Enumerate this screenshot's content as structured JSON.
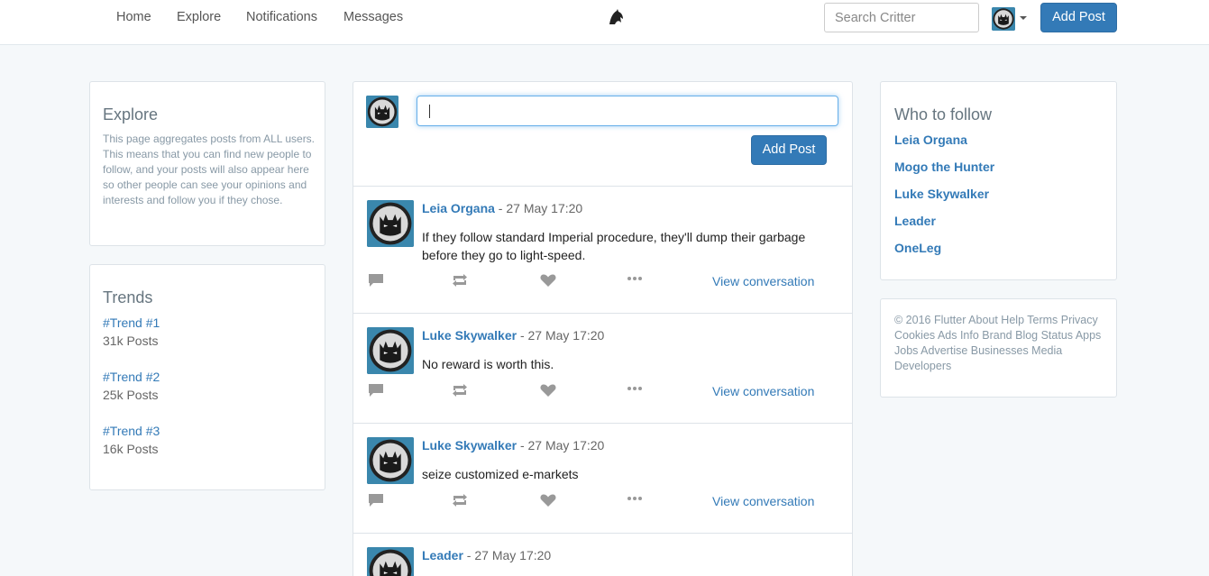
{
  "nav": {
    "links": [
      "Home",
      "Explore",
      "Notifications",
      "Messages"
    ],
    "search_placeholder": "Search Critter",
    "add_post_label": "Add Post"
  },
  "explore": {
    "title": "Explore",
    "description": "This page aggregates posts from ALL users. This means that you can find new people to follow, and your posts will also appear here so other people can see your opinions and interests and follow you if they chose."
  },
  "trends": {
    "title": "Trends",
    "items": [
      {
        "tag": "#Trend #1",
        "count": "31k Posts"
      },
      {
        "tag": "#Trend #2",
        "count": "25k Posts"
      },
      {
        "tag": "#Trend #3",
        "count": "16k Posts"
      }
    ]
  },
  "composer": {
    "value": "",
    "button_label": "Add Post"
  },
  "posts": [
    {
      "author": "Leia Organa",
      "time": " - 27 May 17:20",
      "text": "If they follow standard Imperial procedure, they'll dump their garbage before they go to light-speed.",
      "view_label": "View conversation"
    },
    {
      "author": "Luke Skywalker",
      "time": " - 27 May 17:20",
      "text": "No reward is worth this.",
      "view_label": "View conversation"
    },
    {
      "author": "Luke Skywalker",
      "time": " - 27 May 17:20",
      "text": "seize customized e-markets",
      "view_label": "View conversation"
    },
    {
      "author": "Leader",
      "time": " - 27 May 17:20",
      "text": "",
      "view_label": ""
    }
  ],
  "who_to_follow": {
    "title": "Who to follow",
    "users": [
      "Leia Organa",
      "Mogo the Hunter",
      "Luke Skywalker",
      "Leader",
      "OneLeg"
    ]
  },
  "footer": {
    "text": "© 2016 Flutter About Help Terms Privacy Cookies Ads Info Brand Blog Status Apps Jobs Advertise Businesses Media Developers"
  },
  "colors": {
    "accent": "#337ab7",
    "background": "#f5f8fa",
    "avatar_bg": "#3a87ad"
  }
}
